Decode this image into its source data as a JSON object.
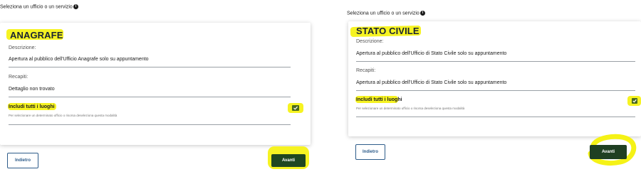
{
  "colors": {
    "accent": "#1f4721",
    "highlight": "#f5f216",
    "outline_button": "#2e5c8a"
  },
  "left": {
    "heading": "Seleziona un ufficio o un servizio",
    "title": "ANAGRAFE",
    "description_label": "Descrizione:",
    "description_value": "Apertura al pubblico dell'Ufficio Anagrafe solo su appuntamento",
    "contacts_label": "Recapiti:",
    "contacts_value": "Dettaglio non trovato",
    "toggle_label": "Includi tutti i luoghi",
    "toggle_help": "Per selezionare un determinato ufficio o risorsa deseleziona questa modalità",
    "back_label": "Indietro",
    "next_label": "Avanti"
  },
  "right": {
    "heading": "Seleziona un ufficio o un servizio",
    "title": "STATO CIVILE",
    "description_label": "Descrizione:",
    "description_value": "Apertura al pubblico dell'Ufficio di Stato Civile solo su appuntamento",
    "contacts_label": "Recapiti:",
    "contacts_value": "Apertura al pubblico dell'Ufficio di Stato Civile solo su appuntamento",
    "toggle_label": "Includi tutti i luoghi",
    "toggle_help": "Per selezionare un determinato ufficio o risorsa deseleziona questa modalità",
    "back_label": "Indietro",
    "next_label": "Avanti"
  }
}
